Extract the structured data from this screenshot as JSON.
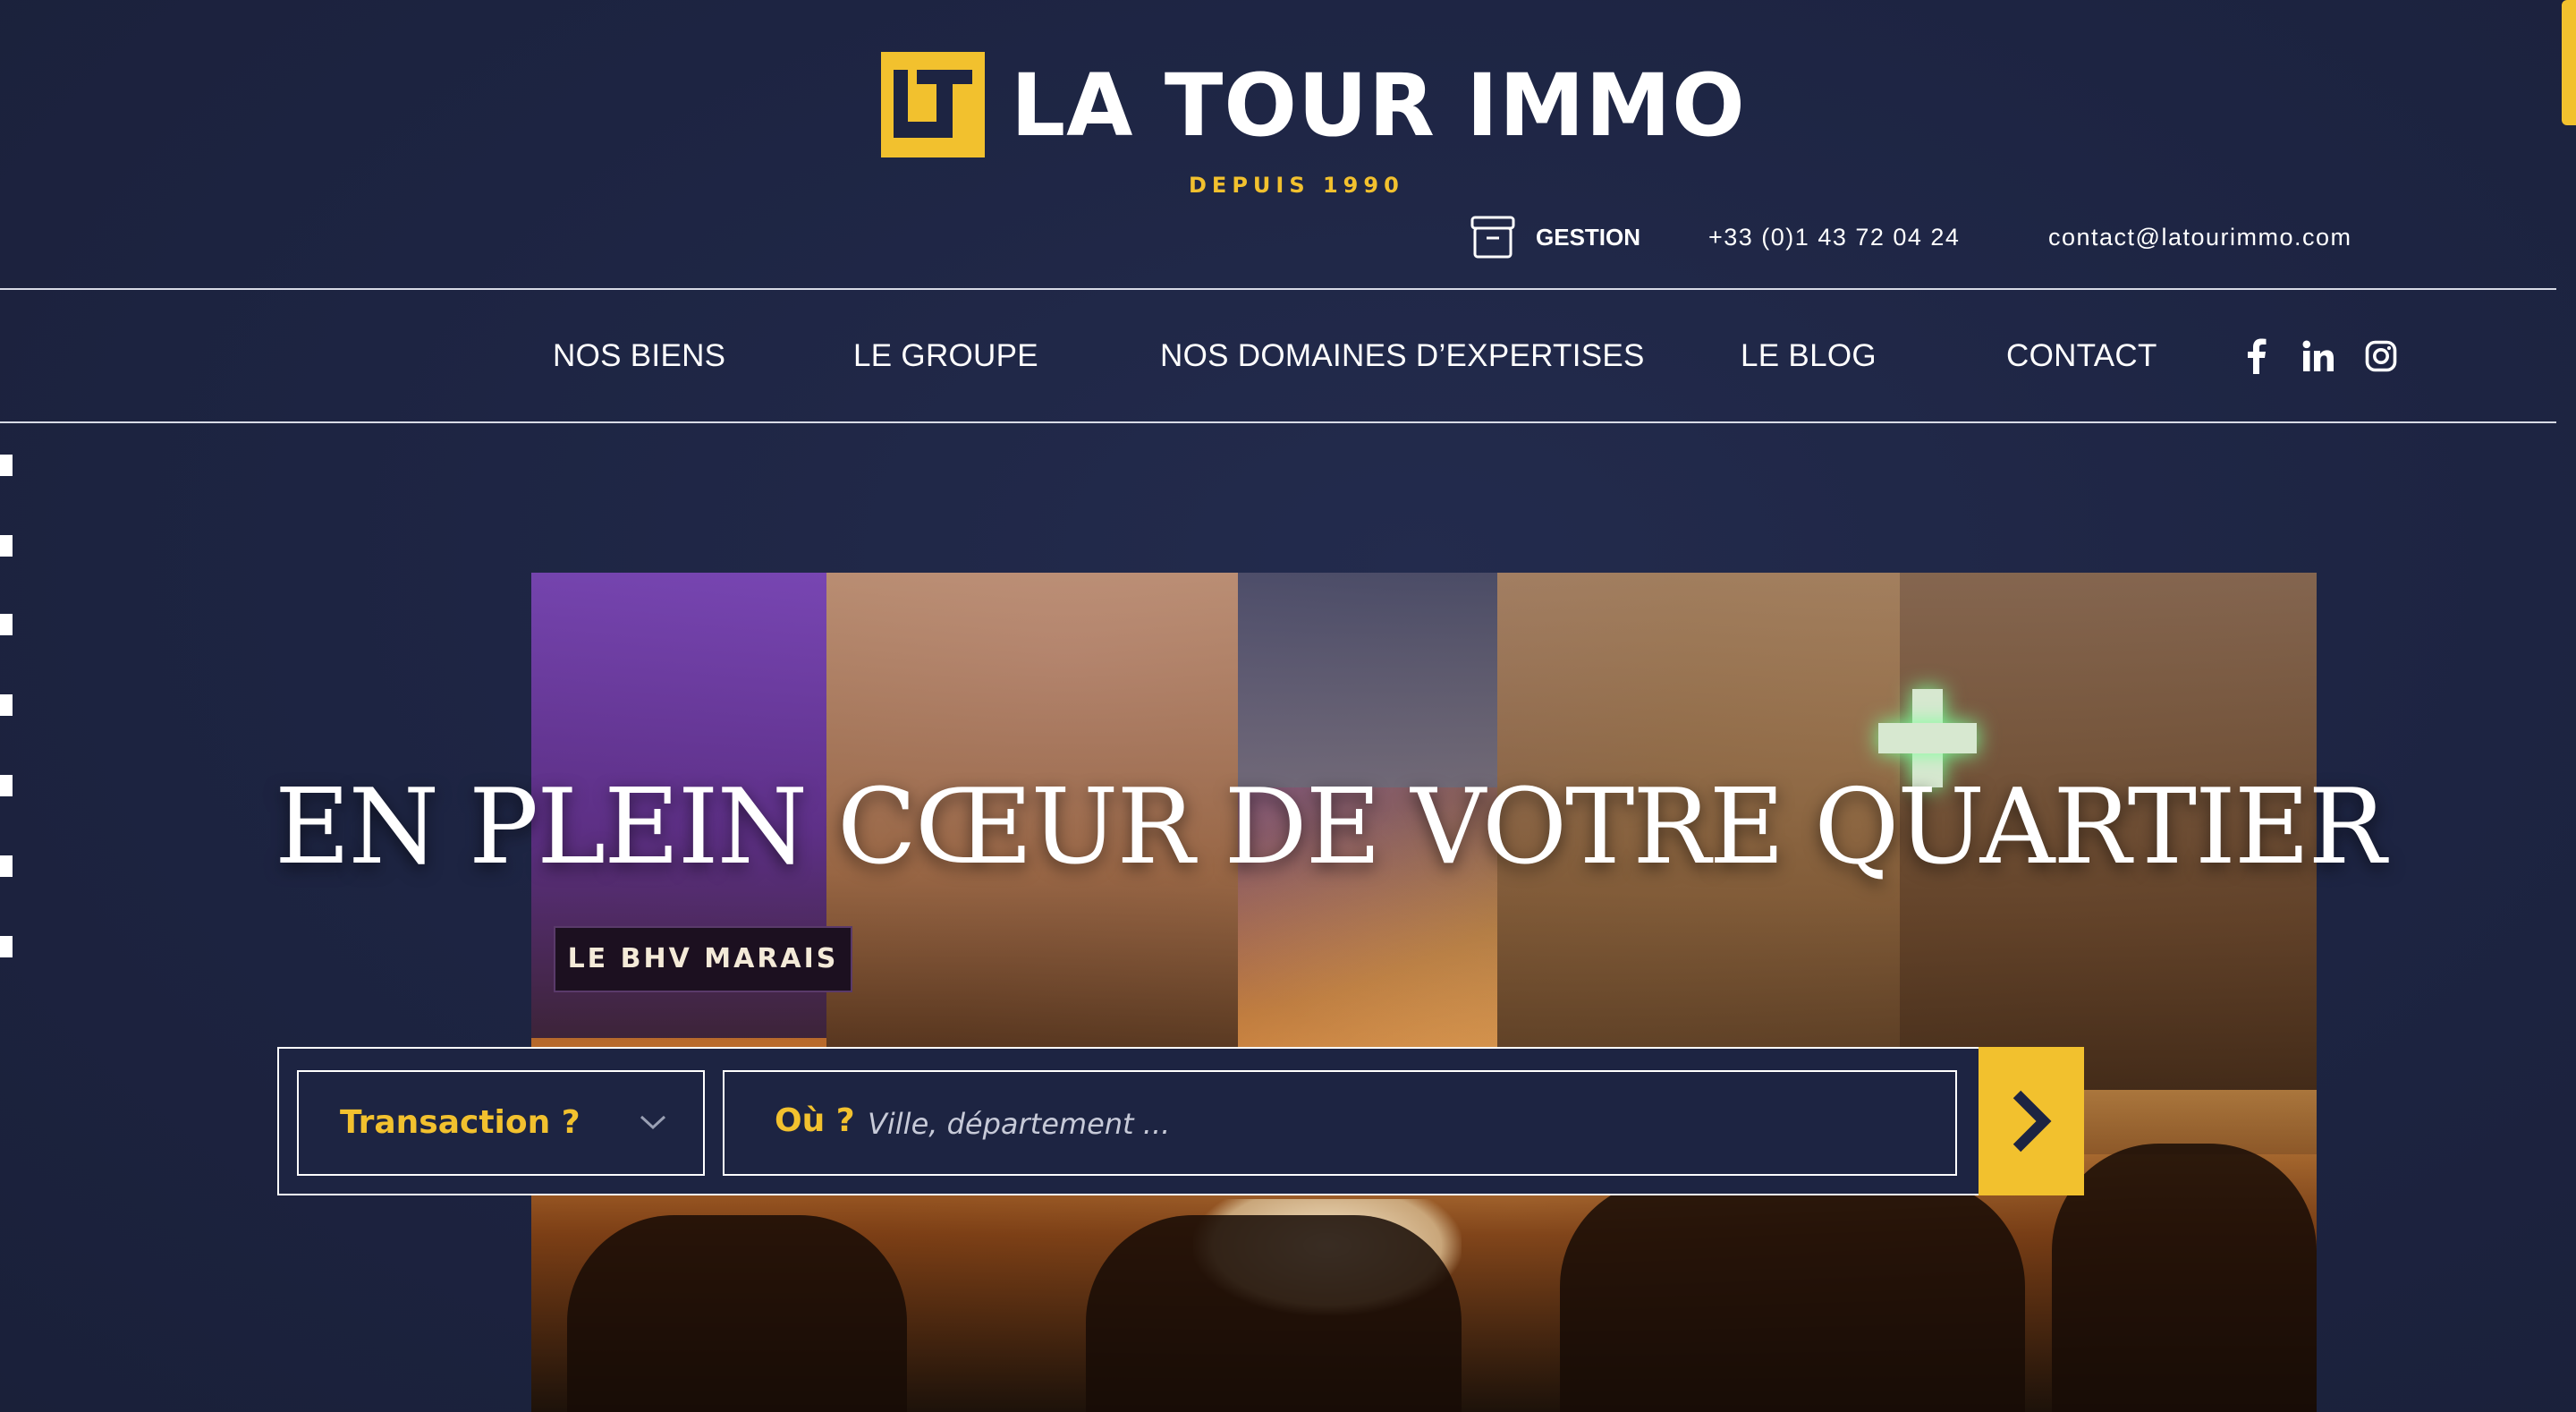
{
  "brand": {
    "name": "LA TOUR IMMO",
    "tagline": "DEPUIS 1990",
    "accent_color": "#f2c12e",
    "background_color": "#1d2442"
  },
  "utility_bar": {
    "gestion": {
      "label": "GESTION",
      "icon": "archive-box-icon"
    },
    "phone": "+33 (0)1 43 72 04 24",
    "email": "contact@latourimmo.com"
  },
  "nav": {
    "items": [
      {
        "label": "NOS BIENS"
      },
      {
        "label": "LE GROUPE"
      },
      {
        "label": "NOS DOMAINES D’EXPERTISES"
      },
      {
        "label": "LE BLOG"
      },
      {
        "label": "CONTACT"
      }
    ],
    "social": [
      {
        "icon": "facebook-icon"
      },
      {
        "icon": "linkedin-icon"
      },
      {
        "icon": "instagram-icon"
      }
    ]
  },
  "hero": {
    "title": "EN PLEIN CŒUR DE VOTRE QUARTIER",
    "photo_sign": "LE BHV MARAIS"
  },
  "search": {
    "transaction_label": "Transaction ?",
    "where_label": "Où ?",
    "where_placeholder": "Ville, département ...",
    "where_value": "",
    "submit_icon": "chevron-right-icon"
  }
}
